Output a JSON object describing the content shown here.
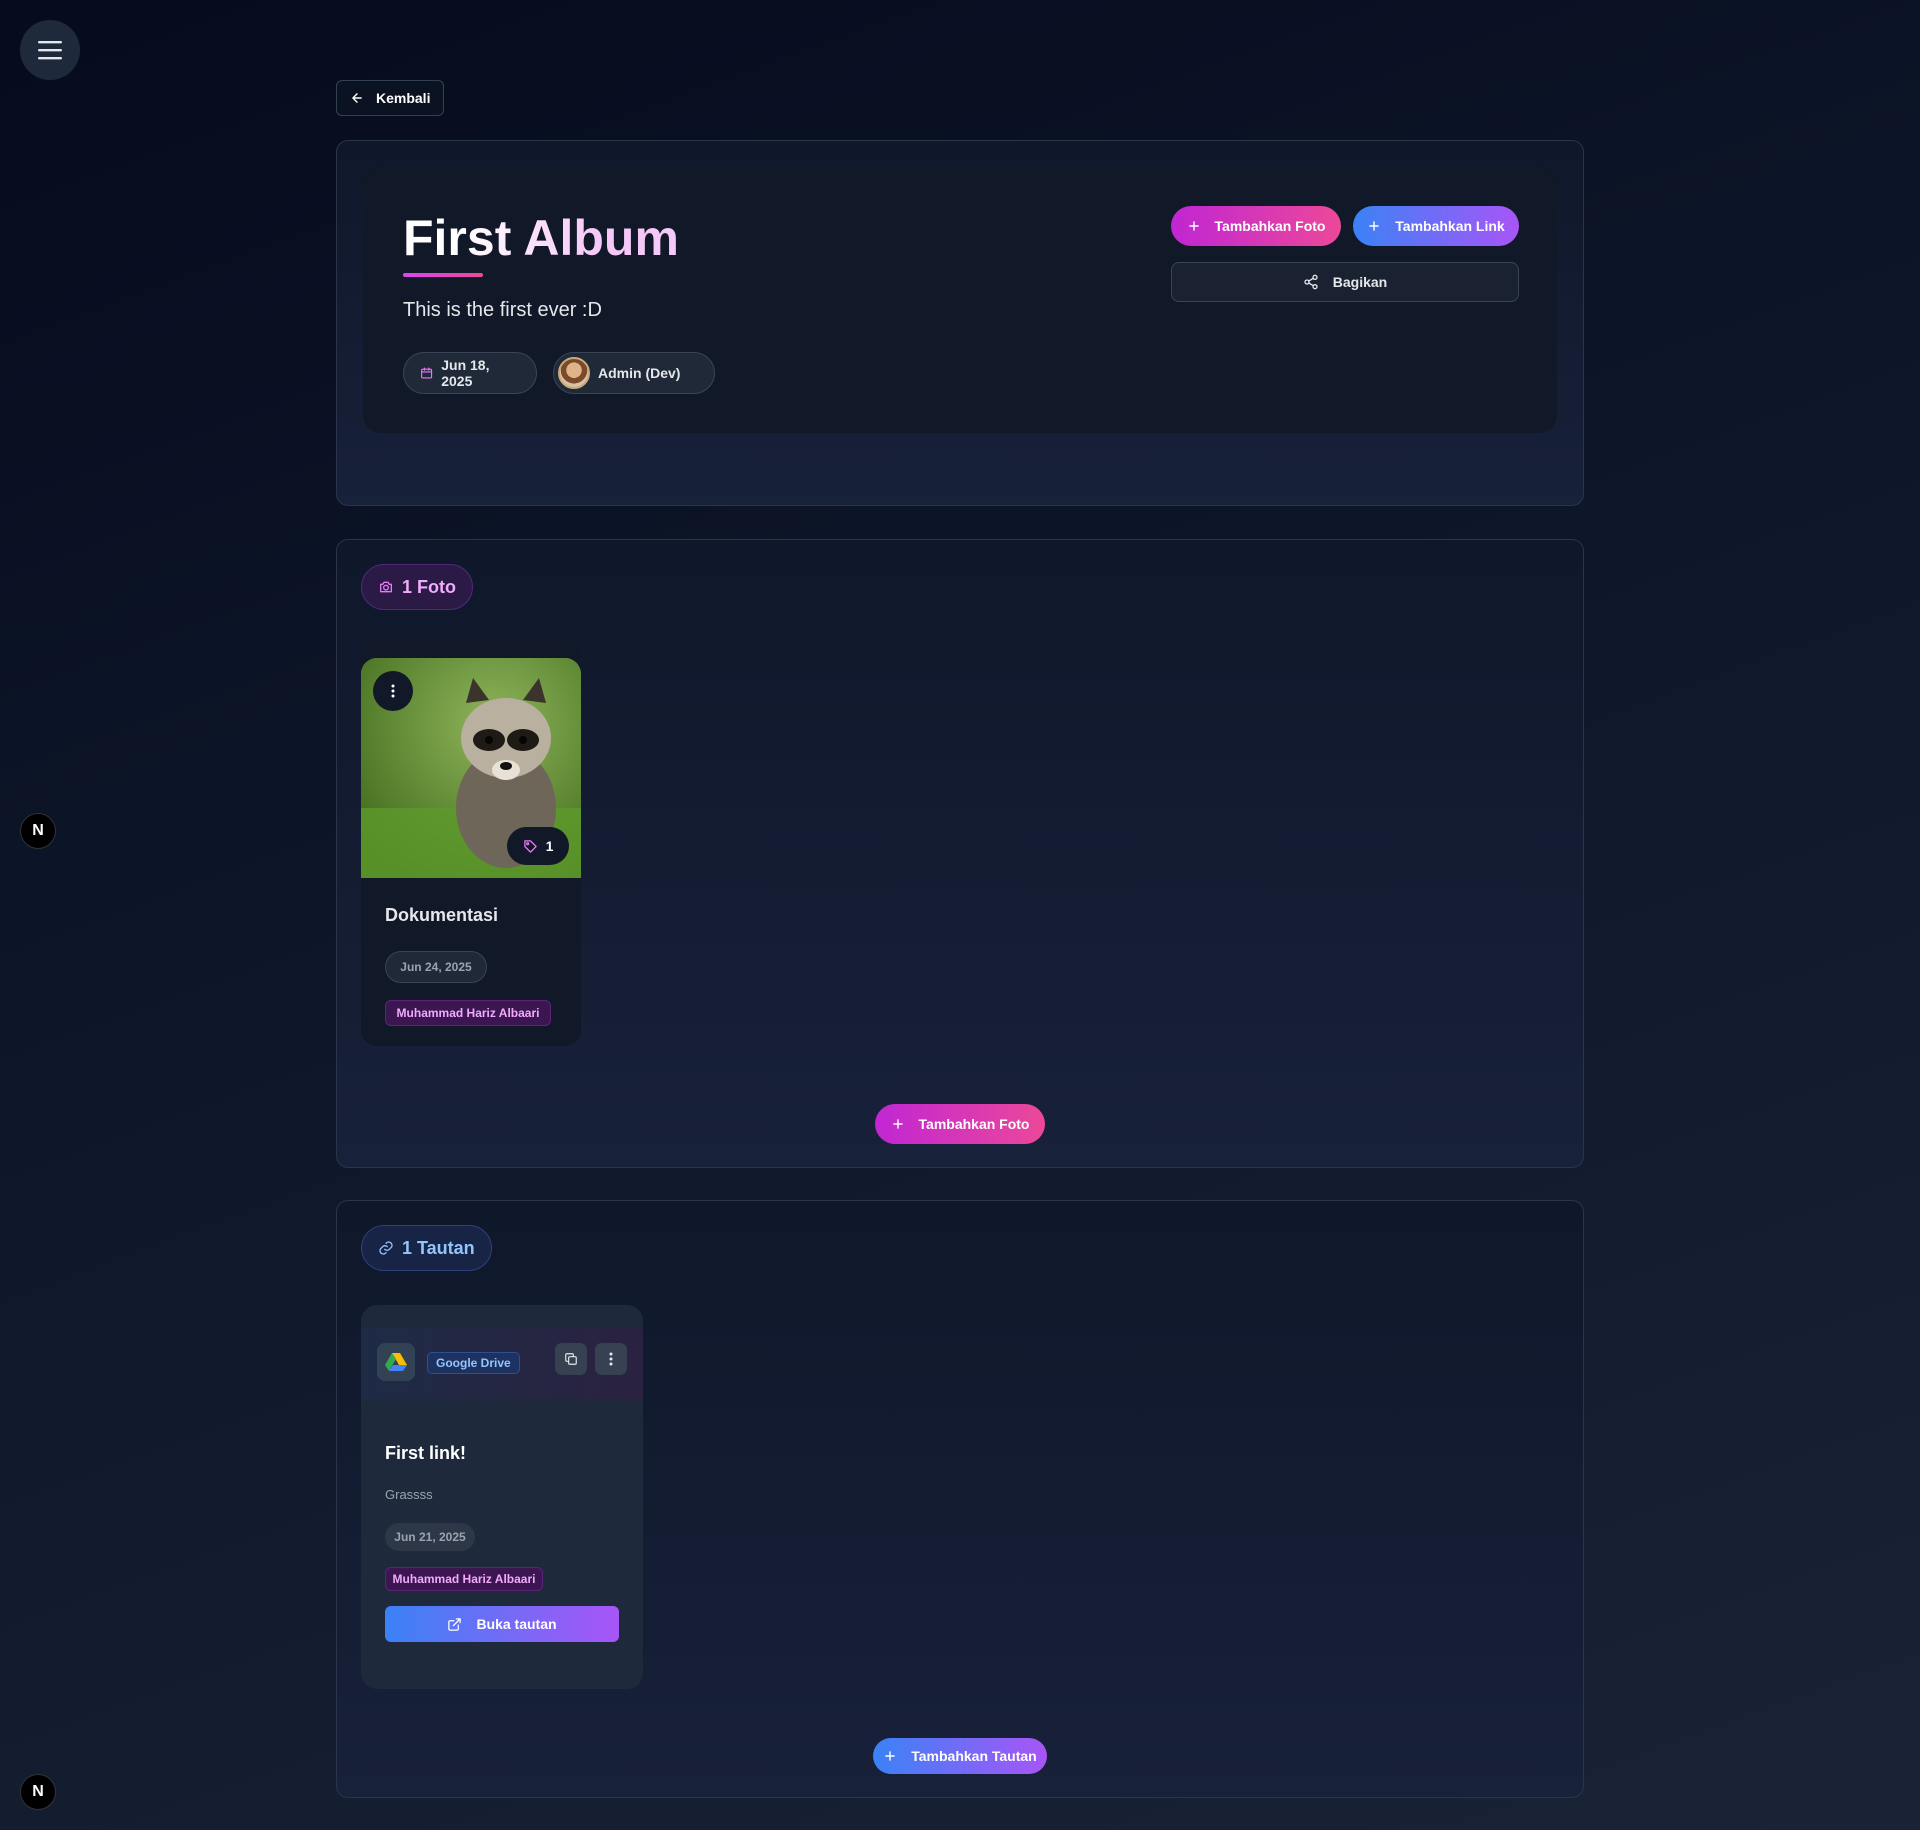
{
  "nav": {
    "back_label": "Kembali",
    "next_badge": "N"
  },
  "album": {
    "title": "First Album",
    "description": "This is the first ever :D",
    "date": "Jun 18, 2025",
    "owner": "Admin (Dev)",
    "add_photo_label": "Tambahkan Foto",
    "add_link_label": "Tambahkan Link",
    "share_label": "Bagikan"
  },
  "photos": {
    "count_label": "1 Foto",
    "items": [
      {
        "title": "Dokumentasi",
        "tag_count": "1",
        "date": "Jun 24, 2025",
        "author": "Muhammad Hariz Albaari"
      }
    ],
    "add_label": "Tambahkan Foto"
  },
  "links": {
    "count_label": "1 Tautan",
    "items": [
      {
        "provider": "Google Drive",
        "title": "First link!",
        "description": "Grassss",
        "date": "Jun 21, 2025",
        "author": "Muhammad Hariz Albaari",
        "open_label": "Buka tautan"
      }
    ],
    "add_label": "Tambahkan Tautan"
  },
  "colors": {
    "accent_pink": "#ec4899",
    "accent_purple": "#a855f7",
    "accent_blue": "#3b82f6",
    "background": "#0b1222"
  }
}
